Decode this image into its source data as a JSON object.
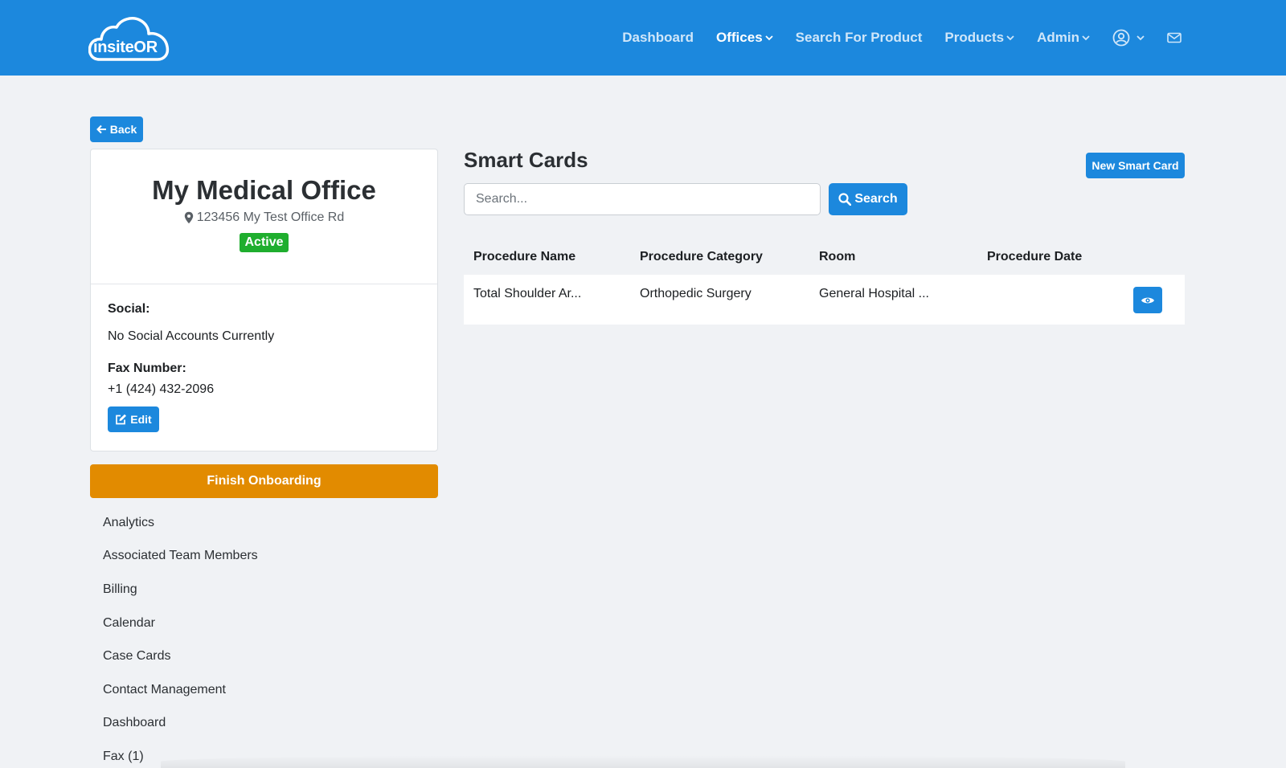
{
  "brand": {
    "logo_text": "insiteOR",
    "primary_color": "#1c88dd",
    "accent_color": "#e28b00",
    "success_color": "#1fae2e"
  },
  "navbar": {
    "items": [
      {
        "label": "Dashboard",
        "dropdown": false,
        "active": false
      },
      {
        "label": "Offices",
        "dropdown": true,
        "active": true
      },
      {
        "label": "Search For Product",
        "dropdown": false,
        "active": false
      },
      {
        "label": "Products",
        "dropdown": true,
        "active": false
      },
      {
        "label": "Admin",
        "dropdown": true,
        "active": false
      }
    ],
    "icons": [
      "user-circle-icon",
      "mail-icon"
    ]
  },
  "back_button": {
    "label": "Back",
    "icon": "arrow-left-icon"
  },
  "office": {
    "name": "My Medical Office",
    "address": "123456 My Test Office Rd",
    "status": "Active",
    "social_label": "Social:",
    "social_value": "No Social Accounts Currently",
    "fax_label": "Fax Number:",
    "fax_value": "+1 (424) 432-2096",
    "edit_label": "Edit"
  },
  "onboarding_button": {
    "label": "Finish Onboarding"
  },
  "side_nav": {
    "items": [
      "Analytics",
      "Associated Team Members",
      "Billing",
      "Calendar",
      "Case Cards",
      "Contact Management",
      "Dashboard",
      "Fax (1)"
    ]
  },
  "smart_cards": {
    "title": "Smart Cards",
    "new_button": "New Smart Card",
    "search": {
      "placeholder": "Search...",
      "value": "",
      "button_label": "Search"
    },
    "columns": [
      "Procedure Name",
      "Procedure Category",
      "Room",
      "Procedure Date"
    ],
    "rows": [
      {
        "procedure_name": "Total Shoulder Ar...",
        "procedure_category": "Orthopedic Surgery",
        "room": "General Hospital ...",
        "procedure_date": ""
      }
    ]
  }
}
